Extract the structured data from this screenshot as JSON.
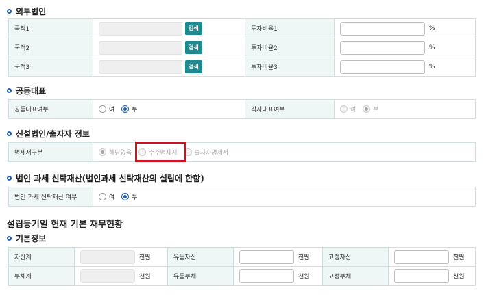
{
  "sections": {
    "foreign": "외투법인",
    "joint": "공동대표",
    "newcorp": "신설법인/출자자 정보",
    "trust": "법인 과세 신탁재산(법인과세 신탁재산의 설립에 한함)",
    "finance_title": "설립등기일 현재 기본 재무현황",
    "basic": "기본정보"
  },
  "foreign_rows": [
    {
      "country_label": "국적1",
      "search": "검색",
      "ratio_label": "투자비율1",
      "unit": "%"
    },
    {
      "country_label": "국적2",
      "search": "검색",
      "ratio_label": "투자비율2",
      "unit": "%"
    },
    {
      "country_label": "국적3",
      "search": "검색",
      "ratio_label": "투자비율3",
      "unit": "%"
    }
  ],
  "joint": {
    "label": "공동대표여부",
    "options": [
      "여",
      "부"
    ],
    "selected": "부",
    "label2": "각자대표여부",
    "options2": [
      "여",
      "부"
    ],
    "selected2": "부"
  },
  "newcorp": {
    "label": "명세서구분",
    "options": [
      "해당없음",
      "주주명세서",
      "출자자명세서"
    ],
    "selected": "해당없음"
  },
  "trust": {
    "label": "법인 과세 신탁재산 여부",
    "options": [
      "여",
      "부"
    ],
    "selected": "부"
  },
  "finance": {
    "rows": [
      {
        "c1": "자산계",
        "u1": "천원",
        "c2": "유동자산",
        "u2": "천원",
        "c3": "고정자산",
        "u3": "천원"
      },
      {
        "c1": "부채계",
        "u1": "천원",
        "c2": "유동부채",
        "u2": "천원",
        "c3": "고정부채",
        "u3": "천원"
      }
    ]
  },
  "colors": {
    "accent": "#1e8a8f",
    "highlight": "#d0101e",
    "label_bg": "#eef6f6"
  }
}
